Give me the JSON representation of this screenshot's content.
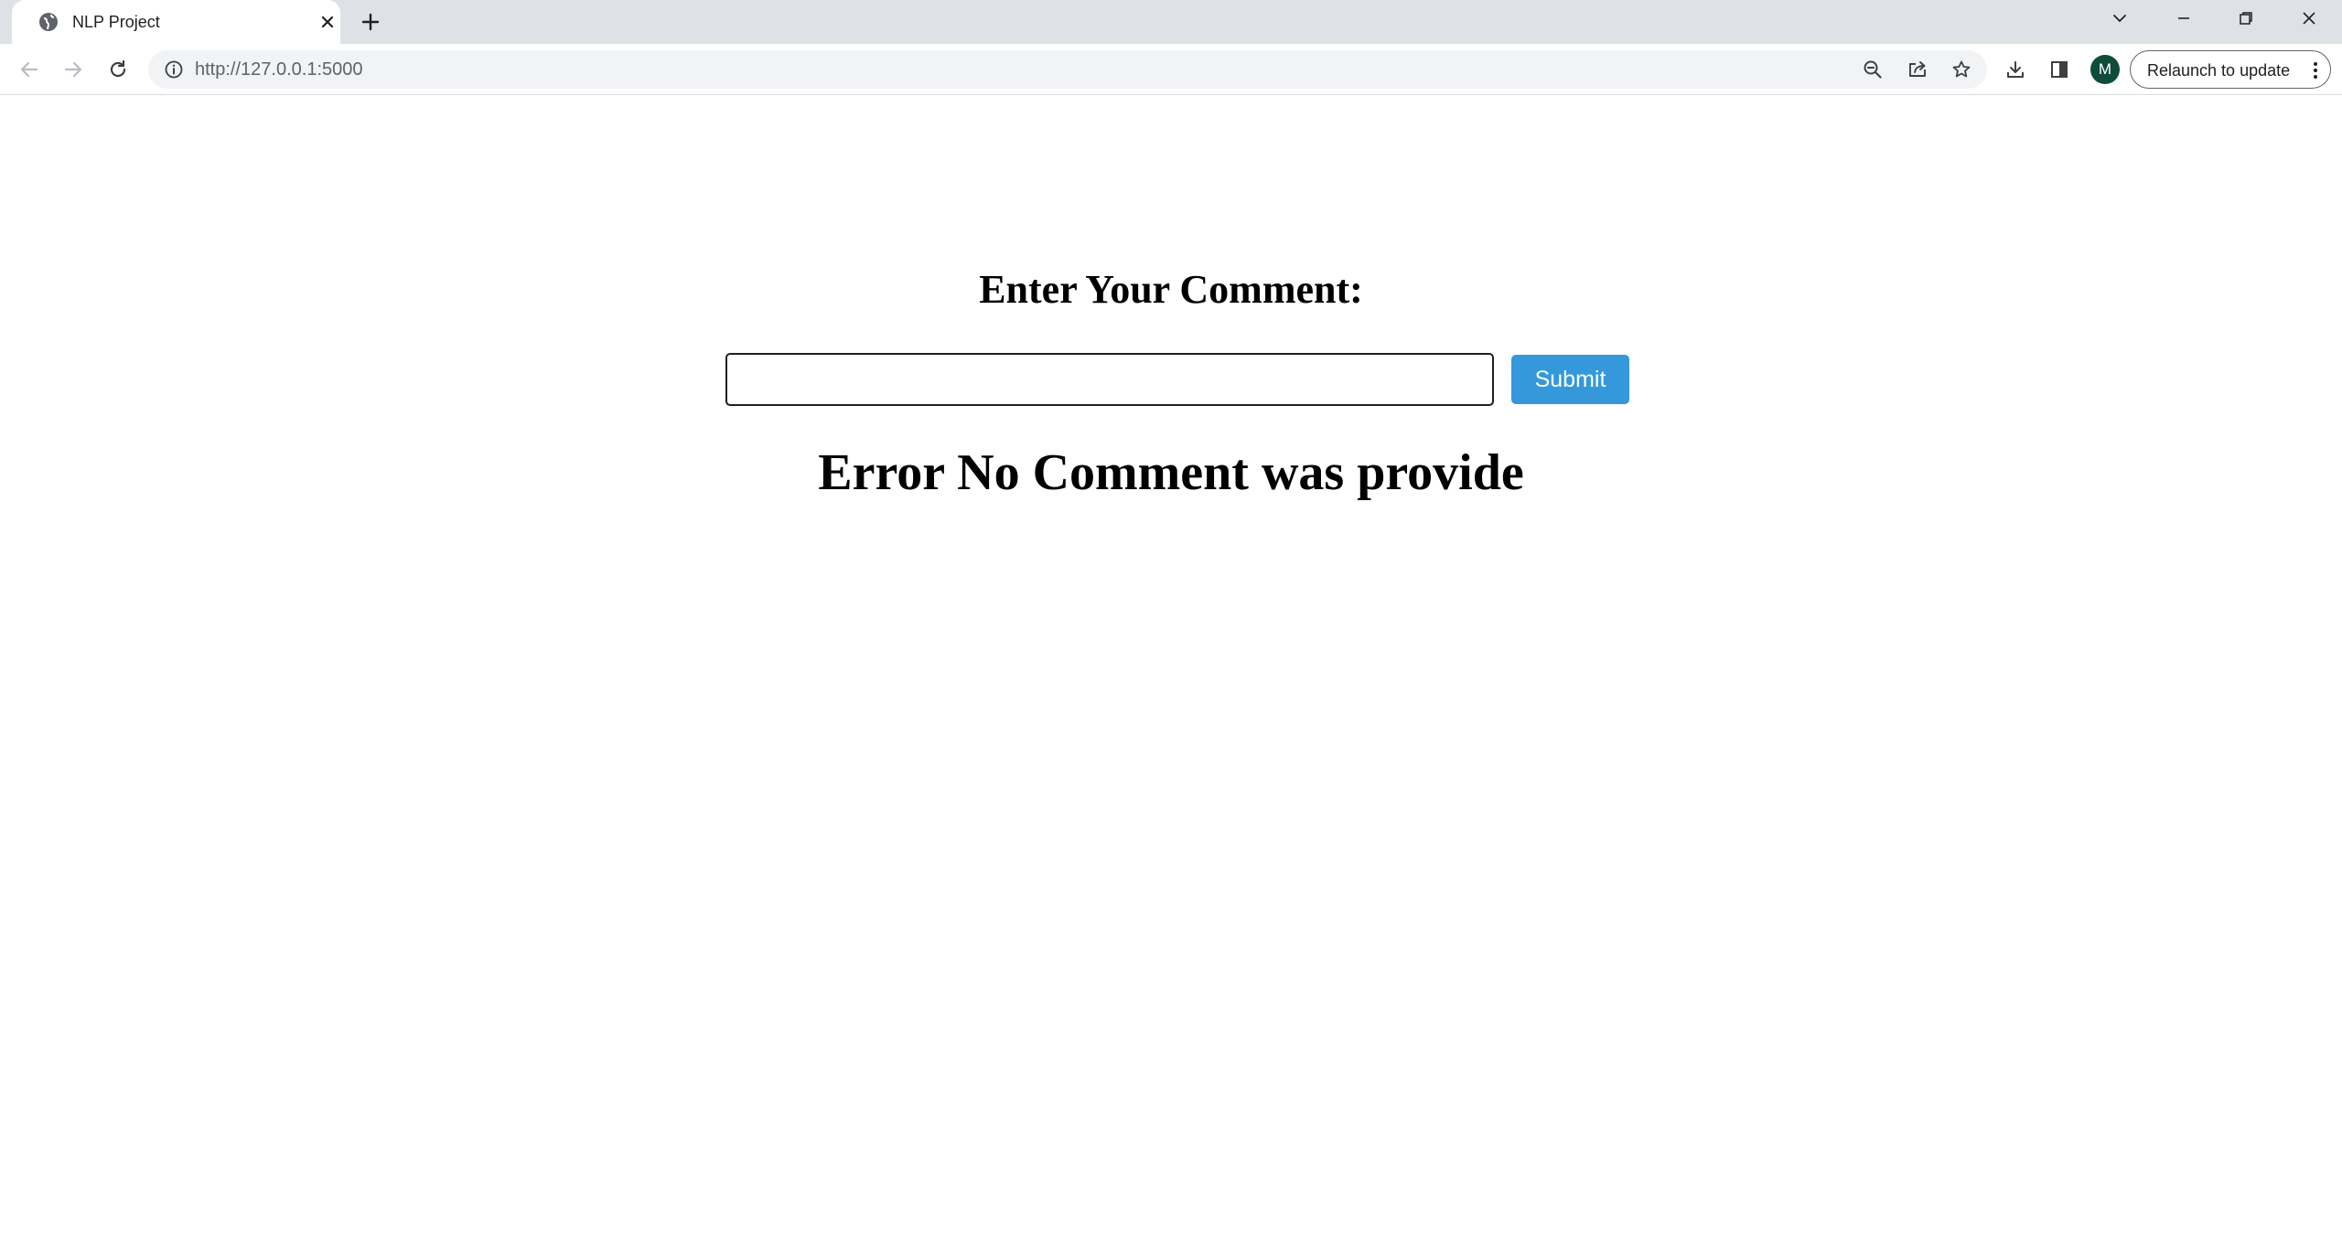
{
  "browser": {
    "tab": {
      "title": "NLP Project",
      "favicon": "globe-icon"
    },
    "url": {
      "scheme_host": "http://127.0.0.1",
      "port": ":5000"
    },
    "avatar_initial": "M",
    "relaunch_label": "Relaunch to update",
    "icons": {
      "back": "arrow-left-icon",
      "forward": "arrow-right-icon",
      "reload": "reload-icon",
      "site_info": "info-icon",
      "zoom": "zoom-out-icon",
      "share": "share-icon",
      "bookmark": "star-icon",
      "downloads": "download-icon",
      "side_panel": "side-panel-icon",
      "menu": "kebab-menu-icon"
    }
  },
  "page": {
    "heading": "Enter Your Comment:",
    "comment_input": {
      "value": "",
      "placeholder": ""
    },
    "submit_label": "Submit",
    "error_message": "Error No Comment was provide"
  },
  "colors": {
    "tabstrip_bg": "#dee1e6",
    "submit_bg": "#3498db",
    "avatar_bg": "#0f4c3a"
  }
}
